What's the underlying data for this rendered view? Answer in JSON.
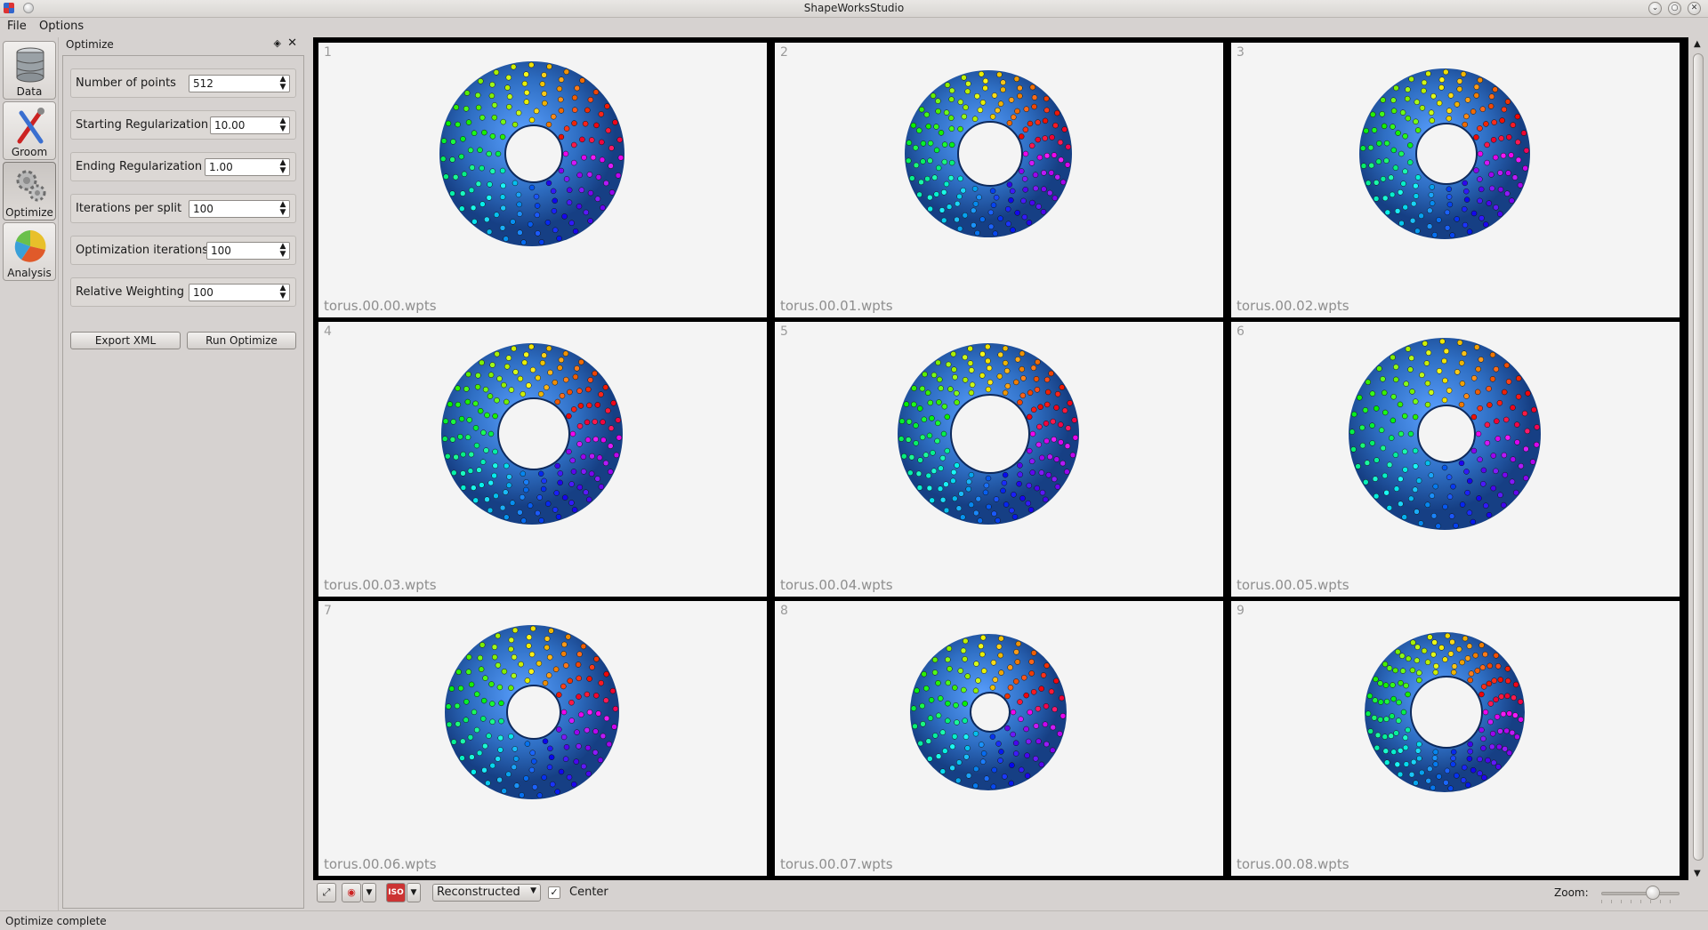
{
  "window": {
    "title": "ShapeWorksStudio",
    "controls": [
      "minimize",
      "maximize",
      "close"
    ]
  },
  "menu": {
    "items": [
      "File",
      "Options"
    ]
  },
  "tools": [
    {
      "label": "Data",
      "icon": "database-icon"
    },
    {
      "label": "Groom",
      "icon": "groom-tools-icon"
    },
    {
      "label": "Optimize",
      "icon": "gears-icon",
      "active": true
    },
    {
      "label": "Analysis",
      "icon": "pie-chart-icon"
    }
  ],
  "panel": {
    "title": "Optimize",
    "params": [
      {
        "label": "Number of points",
        "value": "512"
      },
      {
        "label": "Starting Regularization",
        "value": "10.00"
      },
      {
        "label": "Ending Regularization",
        "value": "1.00"
      },
      {
        "label": "Iterations per split",
        "value": "100"
      },
      {
        "label": "Optimization iterations",
        "value": "100"
      },
      {
        "label": "Relative Weighting",
        "value": "100"
      }
    ],
    "buttons": {
      "export": "Export XML",
      "run": "Run Optimize"
    }
  },
  "viewer": {
    "cells": [
      {
        "index": "1",
        "file": "torus.00.00.wpts"
      },
      {
        "index": "2",
        "file": "torus.00.01.wpts"
      },
      {
        "index": "3",
        "file": "torus.00.02.wpts"
      },
      {
        "index": "4",
        "file": "torus.00.03.wpts"
      },
      {
        "index": "5",
        "file": "torus.00.04.wpts"
      },
      {
        "index": "6",
        "file": "torus.00.05.wpts"
      },
      {
        "index": "7",
        "file": "torus.00.06.wpts"
      },
      {
        "index": "8",
        "file": "torus.00.07.wpts"
      },
      {
        "index": "9",
        "file": "torus.00.08.wpts"
      }
    ],
    "colors": {
      "surface": "#2f6fc4",
      "background": "#f4f4f4"
    }
  },
  "toolbar": {
    "display_mode": "Reconstructed",
    "center_label": "Center",
    "center_checked": true,
    "zoom_label": "Zoom:",
    "zoom_level": 0.7
  },
  "status": {
    "text": "Optimize complete"
  }
}
